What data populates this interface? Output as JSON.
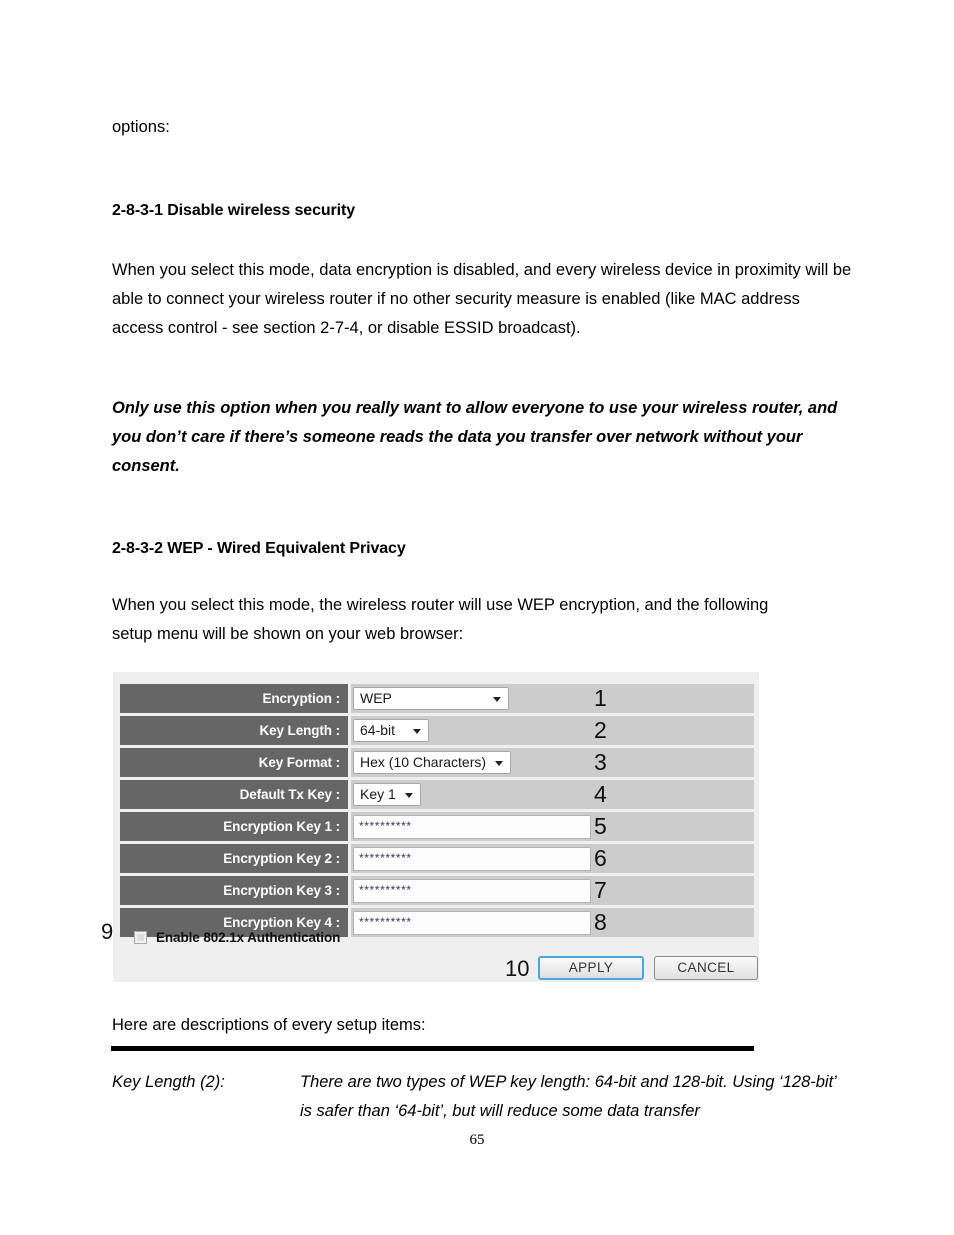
{
  "document": {
    "intro_line": "options:",
    "section_1": {
      "heading": "2-8-3-1 Disable wireless security",
      "paragraph": "When you select this mode, data encryption is disabled, and every wireless device in proximity will be able to connect your wireless router if no other security measure is enabled (like MAC address access control - see section 2-7-4, or disable ESSID broadcast).",
      "emphasis": "Only use this option when you really want to allow everyone to use your wireless router, and you don’t care if there’s someone reads the data you transfer over network without your consent."
    },
    "section_2": {
      "heading": "2-8-3-2 WEP - Wired Equivalent Privacy",
      "paragraph": "When you select this mode, the wireless router will use WEP encryption, and the following setup menu will be shown on your web browser:"
    },
    "after_figure_line": "Here are descriptions of every setup items:",
    "description": {
      "term": "Key Length (2):",
      "body": "There are two types of WEP key length: 64-bit and 128-bit. Using ‘128-bit’ is safer than ‘64-bit’, but will reduce some data transfer"
    },
    "page_number": "65"
  },
  "figure": {
    "rows": [
      {
        "label": "Encryption :",
        "widget": "select",
        "value": "WEP",
        "marker": "1"
      },
      {
        "label": "Key Length :",
        "widget": "select",
        "value": "64-bit",
        "marker": "2"
      },
      {
        "label": "Key Format :",
        "widget": "select",
        "value": "Hex (10 Characters)",
        "marker": "3"
      },
      {
        "label": "Default Tx Key :",
        "widget": "select",
        "value": "Key 1",
        "marker": "4"
      },
      {
        "label": "Encryption Key 1 :",
        "widget": "password",
        "value": "**********",
        "marker": "5"
      },
      {
        "label": "Encryption Key 2 :",
        "widget": "password",
        "value": "**********",
        "marker": "6"
      },
      {
        "label": "Encryption Key 3 :",
        "widget": "password",
        "value": "**********",
        "marker": "7"
      },
      {
        "label": "Encryption Key 4 :",
        "widget": "password",
        "value": "**********",
        "marker": "8"
      }
    ],
    "auth": {
      "marker": "9",
      "label": "Enable 802.1x Authentication",
      "checked": false
    },
    "actions": {
      "marker": "10",
      "apply_label": "APPLY",
      "cancel_label": "CANCEL"
    },
    "colors": {
      "label_bg": "#666666",
      "field_bg": "#cccccc",
      "panel_bg": "#efefef",
      "focus_border": "#49a7e0"
    }
  }
}
